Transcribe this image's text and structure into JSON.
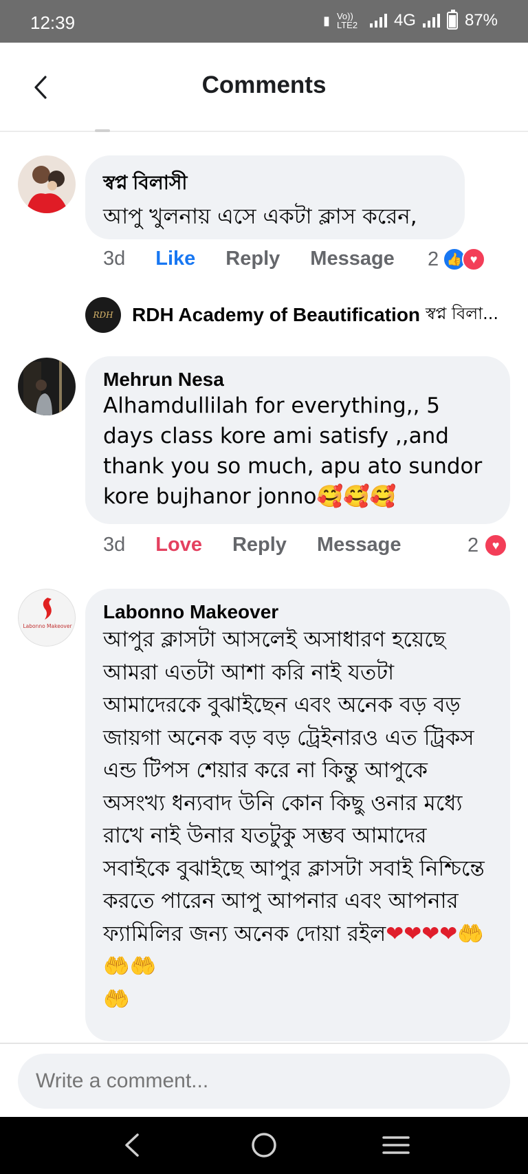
{
  "status_bar": {
    "time": "12:39",
    "network_label": "4G",
    "volte_label": "Vo)) LTE2",
    "battery": "87%"
  },
  "header": {
    "title": "Comments"
  },
  "comments": [
    {
      "author": "স্বপ্ন বিলাসী",
      "text": "আপু খুলনায় এসে একটা ক্লাস করেন,",
      "time": "3d",
      "reaction_action": "Like",
      "reply_label": "Reply",
      "message_label": "Message",
      "reaction_count": "2",
      "reaction_icons": [
        "like-icon",
        "love-icon"
      ]
    },
    {
      "author": "Mehrun Nesa",
      "text": "Alhamdullilah for everything,, 5 days class kore ami satisfy ,,and thank you so much, apu ato sundor kore bujhanor jonno🥰🥰🥰",
      "time": "3d",
      "reaction_action": "Love",
      "reply_label": "Reply",
      "message_label": "Message",
      "reaction_count": "2",
      "reaction_icons": [
        "love-icon"
      ]
    },
    {
      "author": "Labonno Makeover",
      "avatar_text": "Labonno Makeover",
      "text": "আপুর ক্লাসটা আসলেই অসাধারণ হয়েছে আমরা এতটা আশা করি নাই যতটা আমাদেরকে বুঝাইছেন এবং অনেক বড় বড় জায়গা অনেক বড় বড় ট্রেইনারও এত ট্রিকস এন্ড টিপস শেয়ার করে না কিন্তু আপুকে অসংখ্য ধন্যবাদ উনি কোন কিছু ওনার মধ্যে রাখে নাই উনার যতটুকু সম্ভব আমাদের সবাইকে বুঝাইছে  আপুর ক্লাসটা সবাই নিশ্চিন্তে করতে পারেন আপু আপনার এবং আপনার ফ্যামিলির জন্য অনেক দোয়া রইল",
      "emoji_hearts": "❤❤❤❤",
      "emoji_hands": "🤲🤲🤲",
      "emoji_hands_last": "🤲"
    }
  ],
  "reply_preview": {
    "avatar_text": "RDH",
    "author": "RDH Academy of Beautification",
    "snippet": "স্বপ্ন বিলা..."
  },
  "composer": {
    "placeholder": "Write a comment..."
  },
  "navbar": {
    "icons": [
      "back-nav-icon",
      "home-nav-icon",
      "recents-nav-icon"
    ]
  }
}
